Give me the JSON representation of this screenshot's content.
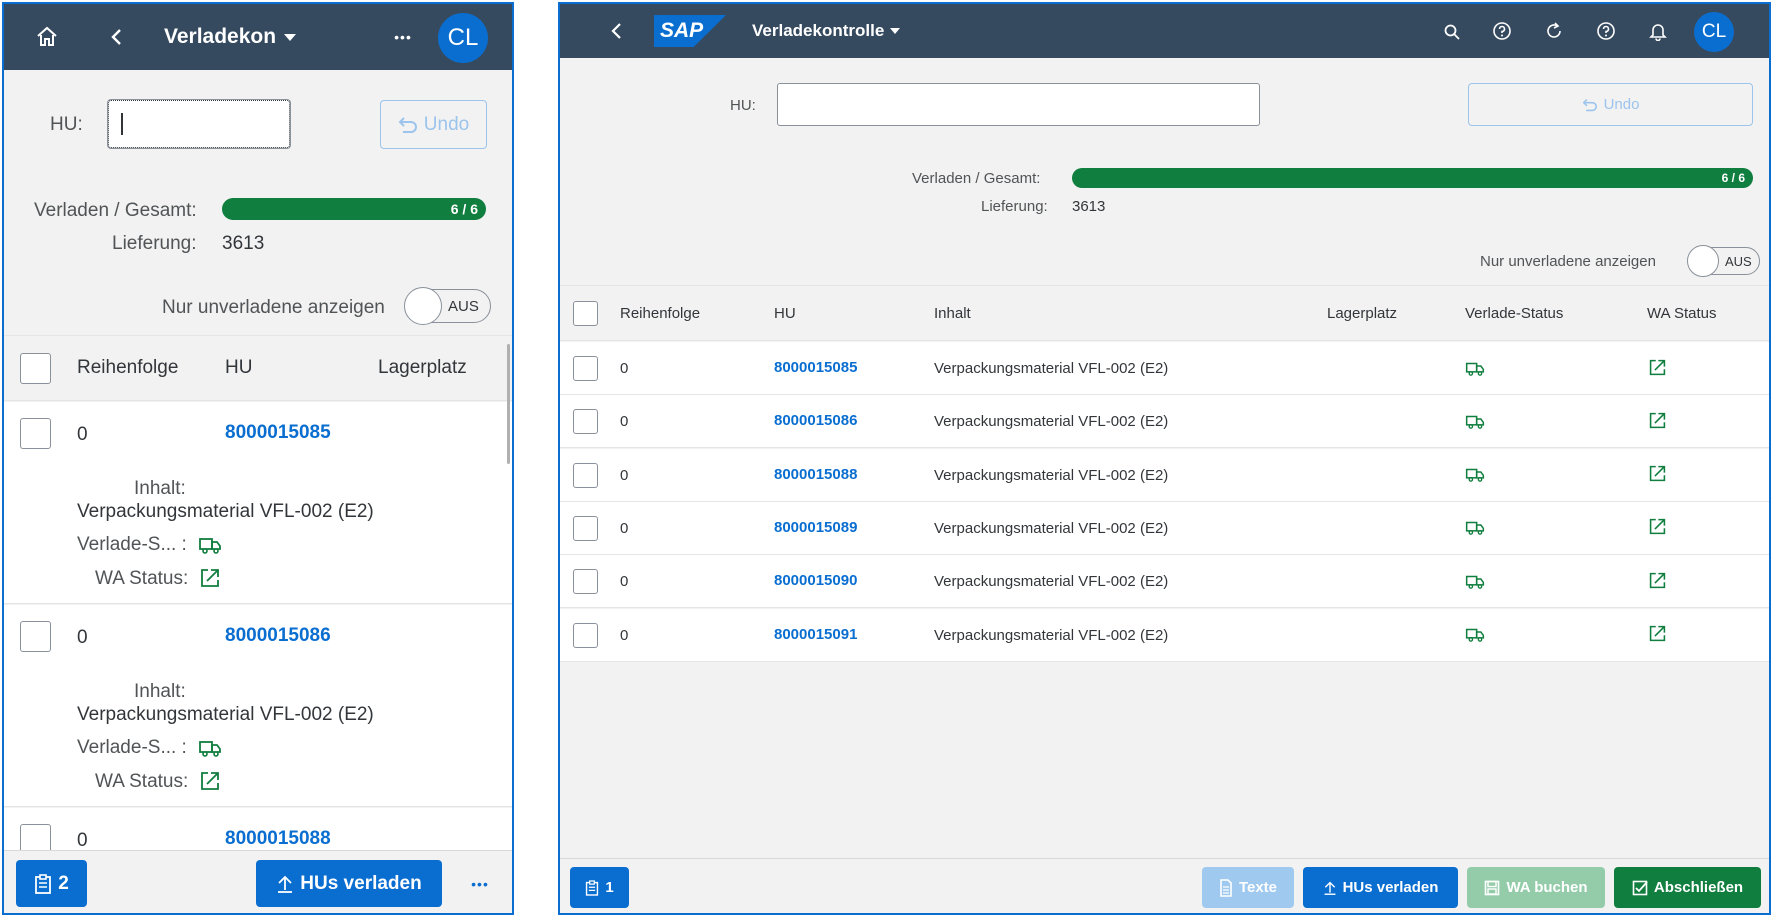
{
  "colors": {
    "shell": "#354a5f",
    "brand": "#0a6ed1",
    "success": "#107e3e",
    "link": "#0a6ed1"
  },
  "phone": {
    "header": {
      "title": "Verladekon",
      "avatar": "CL",
      "home_icon": "home-icon",
      "back_icon": "back-icon",
      "more_label": "•••"
    },
    "form": {
      "hu_label": "HU:",
      "hu_value": "",
      "undo_label": "Undo"
    },
    "progress": {
      "label": "Verladen / Gesamt:",
      "text": "6 / 6",
      "fraction": 1.0
    },
    "delivery": {
      "label": "Lieferung:",
      "value": "3613"
    },
    "toggle": {
      "label": "Nur unverladene anzeigen",
      "state": "AUS"
    },
    "table": {
      "columns": [
        "Reihenfolge",
        "HU",
        "Lagerplatz"
      ],
      "rows": [
        {
          "seq": "0",
          "hu": "8000015085",
          "content_label": "Inhalt:",
          "content": "Verpackungsmaterial VFL-002 (E2)",
          "status_label": "Verlade-S... :",
          "wa_label": "WA Status:"
        },
        {
          "seq": "0",
          "hu": "8000015086",
          "content_label": "Inhalt:",
          "content": "Verpackungsmaterial VFL-002 (E2)",
          "status_label": "Verlade-S... :",
          "wa_label": "WA Status:"
        },
        {
          "seq": "0",
          "hu": "8000015088"
        }
      ]
    },
    "footer": {
      "count_label": "2",
      "load_button": "HUs verladen",
      "more_label": "•••"
    }
  },
  "desktop": {
    "header": {
      "logo": "SAP",
      "title": "Verladekontrolle",
      "avatar": "CL",
      "icons": [
        "search-icon",
        "help-icon",
        "refresh-icon",
        "help-icon",
        "bell-icon"
      ]
    },
    "form": {
      "hu_label": "HU:",
      "hu_value": "",
      "undo_label": "Undo"
    },
    "progress": {
      "label": "Verladen / Gesamt:",
      "text": "6 / 6",
      "fraction": 1.0
    },
    "delivery": {
      "label": "Lieferung:",
      "value": "3613"
    },
    "toggle": {
      "label": "Nur unverladene anzeigen",
      "state": "AUS"
    },
    "table": {
      "columns": [
        "Reihenfolge",
        "HU",
        "Inhalt",
        "Lagerplatz",
        "Verlade-Status",
        "WA Status"
      ],
      "rows": [
        {
          "seq": "0",
          "hu": "8000015085",
          "content": "Verpackungsmaterial VFL-002 (E2)",
          "storage": ""
        },
        {
          "seq": "0",
          "hu": "8000015086",
          "content": "Verpackungsmaterial VFL-002 (E2)",
          "storage": ""
        },
        {
          "seq": "0",
          "hu": "8000015088",
          "content": "Verpackungsmaterial VFL-002 (E2)",
          "storage": ""
        },
        {
          "seq": "0",
          "hu": "8000015089",
          "content": "Verpackungsmaterial VFL-002 (E2)",
          "storage": ""
        },
        {
          "seq": "0",
          "hu": "8000015090",
          "content": "Verpackungsmaterial VFL-002 (E2)",
          "storage": ""
        },
        {
          "seq": "0",
          "hu": "8000015091",
          "content": "Verpackungsmaterial VFL-002 (E2)",
          "storage": ""
        }
      ]
    },
    "footer": {
      "count_label": "1",
      "texts_button": "Texte",
      "load_button": "HUs verladen",
      "wa_button": "WA buchen",
      "finish_button": "Abschließen"
    }
  }
}
